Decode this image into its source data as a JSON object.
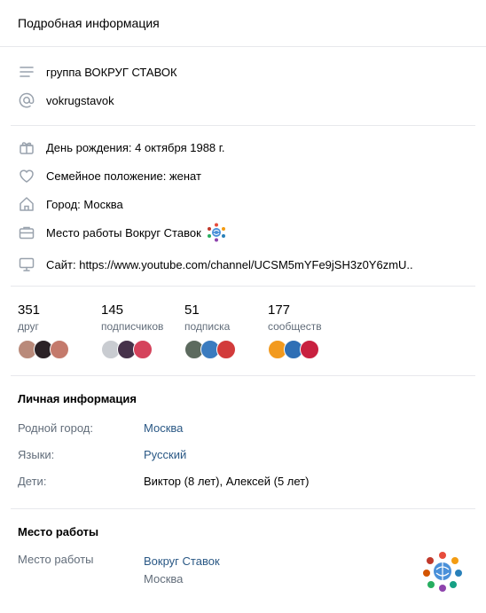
{
  "header": {
    "title": "Подробная информация"
  },
  "about": {
    "status": "группа ВОКРУГ СТАВОК",
    "nickname": "vokrugstavok"
  },
  "details": {
    "birthday_label": "День рождения:",
    "birthday_value": "4 октября 1988 г.",
    "family_label": "Семейное положение:",
    "family_value": "женат",
    "city_label": "Город:",
    "city_value": "Москва",
    "work_label": "Место работы",
    "work_value": "Вокруг Ставок",
    "site_label": "Сайт:",
    "site_value": "https://www.youtube.com/channel/UCSM5mYFe9jSH3z0Y6zmU.."
  },
  "counters": [
    {
      "num": "351",
      "label": "друг"
    },
    {
      "num": "145",
      "label": "подписчиков"
    },
    {
      "num": "51",
      "label": "подписка"
    },
    {
      "num": "177",
      "label": "сообществ"
    }
  ],
  "avatar_colors": [
    [
      "#b98a7a",
      "#2b2226",
      "#c47a6c"
    ],
    [
      "#c9ccd1",
      "#46324a",
      "#d5435c"
    ],
    [
      "#5c6a5e",
      "#3a7bbf",
      "#d23b3b"
    ],
    [
      "#f29a1f",
      "#2f6fb5",
      "#c8203f"
    ]
  ],
  "personal": {
    "title": "Личная информация",
    "rows": [
      {
        "key": "Родной город:",
        "value": "Москва"
      },
      {
        "key": "Языки:",
        "value": "Русский"
      },
      {
        "key": "Дети:",
        "value": "Виктор (8 лет), Алексей (5 лет)"
      }
    ]
  },
  "job": {
    "title": "Место работы",
    "key": "Место работы",
    "company": "Вокруг Ставок",
    "city": "Москва"
  },
  "colors": {
    "link": "#2a5885",
    "grey": "#626d7a",
    "divider": "#e7e8ec"
  }
}
